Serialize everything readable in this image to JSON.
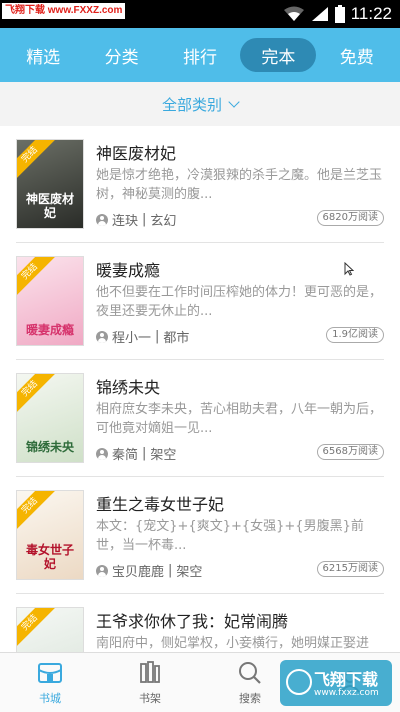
{
  "status_bar": {
    "watermark": "飞翔下载 www.FXXZ.com",
    "time": "11:22"
  },
  "tabs": [
    {
      "label": "精选",
      "active": false
    },
    {
      "label": "分类",
      "active": false
    },
    {
      "label": "排行",
      "active": false
    },
    {
      "label": "完本",
      "active": true
    },
    {
      "label": "免费",
      "active": false
    }
  ],
  "category_filter": {
    "label": "全部类别"
  },
  "books": [
    {
      "ribbon": "完结",
      "title": "神医废材妃",
      "desc": "她是惊才绝艳，冷漠狠辣的杀手之魔。他是兰芝玉树，神秘莫测的腹...",
      "author": "连玦",
      "genre": "玄幻",
      "reads": "6820万阅读",
      "cover_text": "神医废材妃",
      "cover_bg": "#3b3f3a",
      "cover_accent": "#c0392b"
    },
    {
      "ribbon": "完结",
      "title": "暖妻成瘾",
      "desc": "他不但要在工作时间压榨她的体力！更可恶的是，夜里还要无休止的...",
      "author": "程小一",
      "genre": "都市",
      "reads": "1.9亿阅读",
      "cover_text": "暖妻成瘾",
      "cover_bg": "#f3c7d8",
      "cover_accent": "#d6336c"
    },
    {
      "ribbon": "完结",
      "title": "锦绣未央",
      "desc": "相府庶女李未央，苦心相助夫君，八年一朝为后，可他竟对嫡姐一见...",
      "author": "秦简",
      "genre": "架空",
      "reads": "6568万阅读",
      "cover_text": "锦绣未央",
      "cover_bg": "#e7efe4",
      "cover_accent": "#2e6b3a"
    },
    {
      "ribbon": "完结",
      "title": "重生之毒女世子妃",
      "desc": "本文：{宠文}+{爽文}+{女强}+{男腹黑}前世，当一杯毒...",
      "author": "宝贝鹿鹿",
      "genre": "架空",
      "reads": "6215万阅读",
      "cover_text": "毒女世子妃",
      "cover_bg": "#f5efe6",
      "cover_accent": "#b3122b"
    },
    {
      "ribbon": "完结",
      "title": "王爷求你休了我：妃常闹腾",
      "desc": "南阳府中，侧妃掌权，小妾横行，她明媒正娶进",
      "author": "",
      "genre": "",
      "reads": "",
      "cover_text": "",
      "cover_bg": "#eef2ee",
      "cover_accent": "#555"
    }
  ],
  "bottom_nav": [
    {
      "label": "书城",
      "active": true,
      "icon": "home-icon"
    },
    {
      "label": "书架",
      "active": false,
      "icon": "bookshelf-icon"
    },
    {
      "label": "搜索",
      "active": false,
      "icon": "search-icon"
    },
    {
      "label": "",
      "active": false,
      "icon": "profile-icon"
    }
  ],
  "watermark_br": {
    "name": "飞翔下载",
    "url": "www.fxxz.com"
  },
  "colors": {
    "accent": "#4fbde9",
    "active_tab": "#2e8ab4",
    "link": "#3aa9de",
    "ribbon": "#f5b400"
  }
}
